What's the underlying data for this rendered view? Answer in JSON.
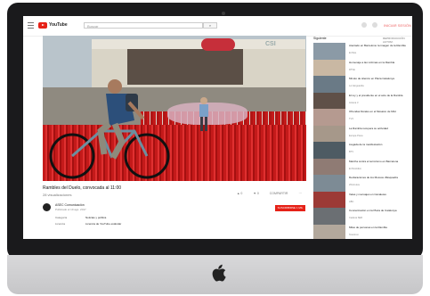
{
  "colors": {
    "accent": "#e62117",
    "frame": "#1a1a1c",
    "chin": "#cfcfd1"
  },
  "header": {
    "logo_text": "YouTube",
    "search_placeholder": "Buscar",
    "search_button": "⌕",
    "signin_label": "INICIAR SESIÓN"
  },
  "video": {
    "title": "Rambles del Duelo, convocada al 11:00",
    "views": "28 visualizaciones",
    "actions": {
      "like": "▲ 0",
      "dislike": "▼ 0",
      "share": "COMPARTIR",
      "more": "···"
    },
    "channel_name": "ASEC Comunicación",
    "channel_date": "Publicado el 19 ago. 2017",
    "subscribe_label": "SUSCRIBIRSE 1 MIL",
    "meta": [
      {
        "label": "Categoría",
        "value": "Noticias y política"
      },
      {
        "label": "Licencia",
        "value": "Licencia de YouTube estándar"
      }
    ]
  },
  "sidebar": {
    "next_label": "Siguiente",
    "autoplay_label": "REPRODUCCIÓN AUTOM.",
    "items": [
      {
        "title": "Atentado en Barcelona: la imagen de la Rambla",
        "sub": "El País",
        "thumb": "#8b9aa6"
      },
      {
        "title": "Homenaje a las víctimas en la Rambla",
        "sub": "RTVE",
        "thumb": "#c9b8a3"
      },
      {
        "title": "Minuto de silencio en Plaza Catalunya",
        "sub": "La Vanguardia",
        "thumb": "#6a7a86"
      },
      {
        "title": "El rey y el presidente en el acto de la Rambla",
        "sub": "Antena 3",
        "thumb": "#5f5048"
      },
      {
        "title": "Ofrendas florales en el Mosaico de Miró",
        "sub": "TV3",
        "thumb": "#b59a90"
      },
      {
        "title": "La Rambla recupera su actividad",
        "sub": "Europa Press",
        "thumb": "#a6988a"
      },
      {
        "title": "Llegada de la manifestación",
        "sub": "BTV",
        "thumb": "#4e5b63"
      },
      {
        "title": "Marcha contra el terrorismo en Barcelona",
        "sub": "El Periódico",
        "thumb": "#8f7b74"
      },
      {
        "title": "Declaraciones de los Mossos d'Esquadra",
        "sub": "20minutos",
        "thumb": "#7d8b95"
      },
      {
        "title": "Velas y mensajes en Canaletes",
        "sub": "ABC",
        "thumb": "#9c3a36"
      },
      {
        "title": "Concentración en la Plaza de Catalunya",
        "sub": "Cadena SER",
        "thumb": "#6b6f73"
      },
      {
        "title": "Miles de personas en la Rambla",
        "sub": "Telecinco",
        "thumb": "#b3a89c"
      }
    ]
  }
}
